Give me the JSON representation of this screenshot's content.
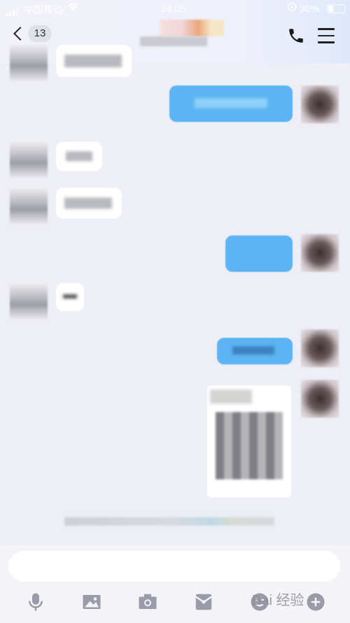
{
  "status_bar": {
    "carrier": "中国移动",
    "time": "14:05",
    "battery": "30%"
  },
  "header": {
    "back_badge": "13"
  },
  "input": {
    "placeholder": ""
  },
  "watermark": "Bai 经验"
}
